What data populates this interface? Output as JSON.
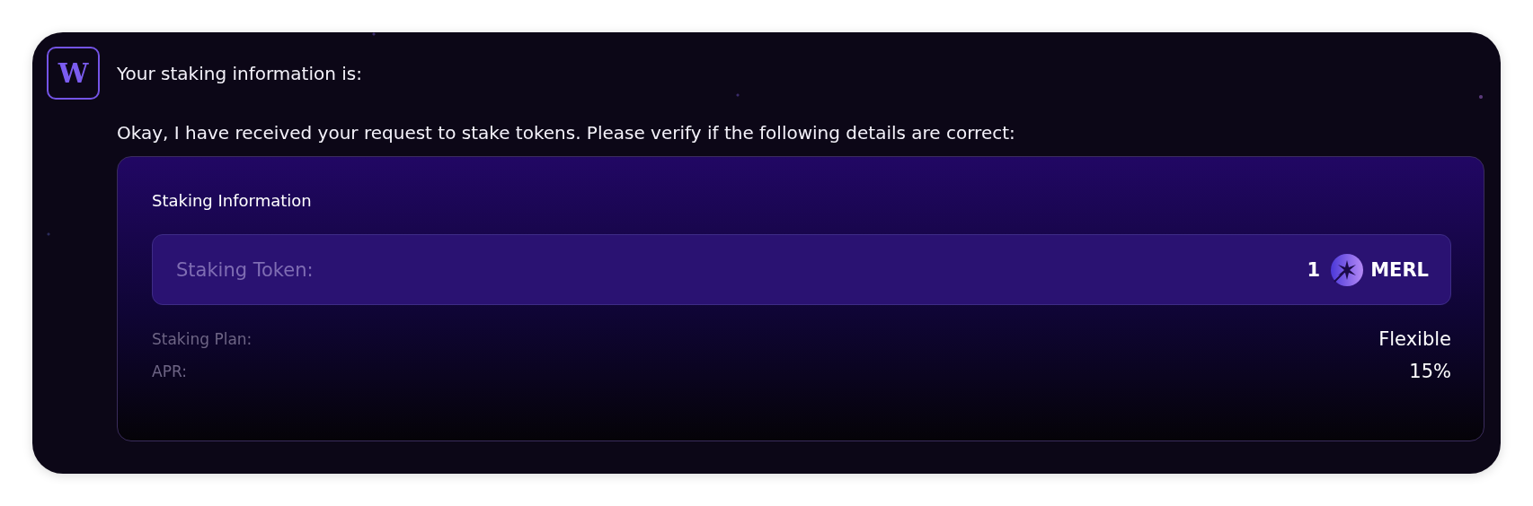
{
  "assistant": {
    "logo": "W"
  },
  "messages": [
    "Your staking information is:",
    "Okay, I have received your request to stake tokens. Please verify if the following details are correct:"
  ],
  "staking_card": {
    "title": "Staking Information",
    "token": {
      "label": "Staking Token:",
      "amount": "1",
      "symbol": "MERL"
    },
    "details": [
      {
        "label": "Staking Plan:",
        "value": "Flexible"
      },
      {
        "label": "APR:",
        "value": "15%"
      }
    ]
  }
}
